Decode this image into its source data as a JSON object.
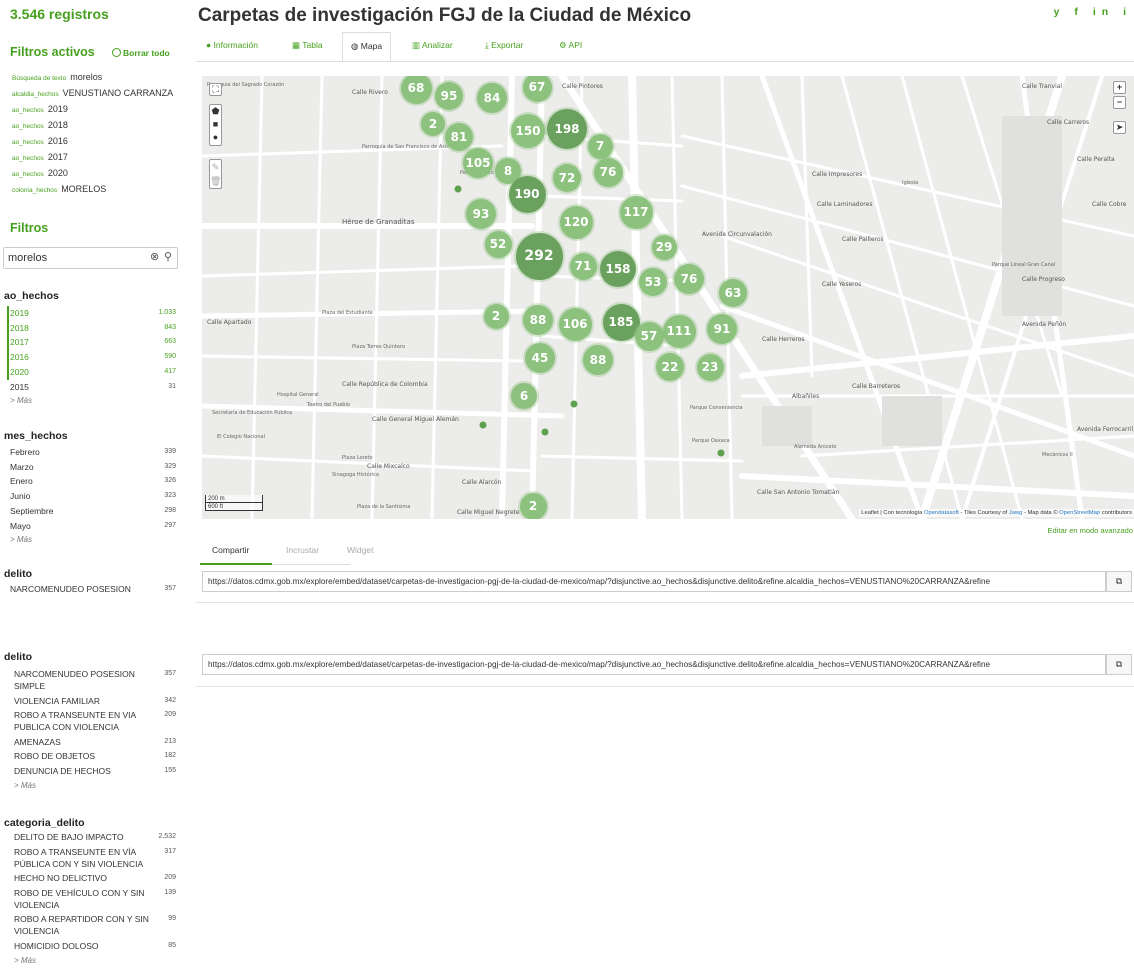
{
  "sidebar": {
    "record_count": "3.546 registros",
    "active_filters_title": "Filtros activos",
    "clear_all": "Borrar todo",
    "active_filters": [
      {
        "field": "Búsqueda de texto",
        "value": "morelos"
      },
      {
        "field": "alcaldia_hechos",
        "value": "VENUSTIANO CARRANZA"
      },
      {
        "field": "ao_hechos",
        "value": "2019"
      },
      {
        "field": "ao_hechos",
        "value": "2018"
      },
      {
        "field": "ao_hechos",
        "value": "2016"
      },
      {
        "field": "ao_hechos",
        "value": "2017"
      },
      {
        "field": "ao_hechos",
        "value": "2020"
      },
      {
        "field": "colonia_hechos",
        "value": "MORELOS"
      }
    ],
    "filters_title": "Filtros",
    "search_value": "morelos",
    "facets": {
      "ao_hechos": {
        "title": "ao_hechos",
        "items": [
          {
            "label": "2019",
            "count": "1.033",
            "selected": true
          },
          {
            "label": "2018",
            "count": "843",
            "selected": true
          },
          {
            "label": "2017",
            "count": "663",
            "selected": true
          },
          {
            "label": "2016",
            "count": "590",
            "selected": true
          },
          {
            "label": "2020",
            "count": "417",
            "selected": true
          },
          {
            "label": "2015",
            "count": "31",
            "selected": false
          }
        ],
        "more": "> Más"
      },
      "mes_hechos": {
        "title": "mes_hechos",
        "items": [
          {
            "label": "Febrero",
            "count": "339"
          },
          {
            "label": "Marzo",
            "count": "329"
          },
          {
            "label": "Enero",
            "count": "326"
          },
          {
            "label": "Junio",
            "count": "323"
          },
          {
            "label": "Septiembre",
            "count": "298"
          },
          {
            "label": "Mayo",
            "count": "297"
          }
        ],
        "more": "> Más"
      },
      "delito_cut": {
        "title": "delito",
        "first": "NARCOMENUDEO POSESION",
        "first_count": "357"
      },
      "delito": {
        "title": "delito",
        "items": [
          {
            "label": "NARCOMENUDEO POSESION SIMPLE",
            "count": "357"
          },
          {
            "label": "VIOLENCIA FAMILIAR",
            "count": "342"
          },
          {
            "label": "ROBO A TRANSEUNTE EN VIA PUBLICA CON VIOLENCIA",
            "count": "209"
          },
          {
            "label": "AMENAZAS",
            "count": "213"
          },
          {
            "label": "ROBO DE OBJETOS",
            "count": "182"
          },
          {
            "label": "DENUNCIA DE HECHOS",
            "count": "155"
          }
        ],
        "more": "> Más"
      },
      "categoria_delito": {
        "title": "categoria_delito",
        "items": [
          {
            "label": "DELITO DE BAJO IMPACTO",
            "count": "2.532"
          },
          {
            "label": "ROBO A TRANSEUNTE EN VÍA PÚBLICA CON Y SIN VIOLENCIA",
            "count": "317"
          },
          {
            "label": "HECHO NO DELICTIVO",
            "count": "209"
          },
          {
            "label": "ROBO DE VEHÍCULO CON Y SIN VIOLENCIA",
            "count": "139"
          },
          {
            "label": "ROBO A REPARTIDOR CON Y SIN VIOLENCIA",
            "count": "99"
          },
          {
            "label": "HOMICIDIO DOLOSO",
            "count": "85"
          }
        ],
        "more": "> Más"
      }
    }
  },
  "main": {
    "title": "Carpetas de investigación FGJ de la Ciudad de México",
    "social": [
      "y",
      "f",
      "in",
      "i"
    ],
    "tabs": [
      {
        "label": "Información",
        "icon": "info-icon"
      },
      {
        "label": "Tabla",
        "icon": "table-icon"
      },
      {
        "label": "Mapa",
        "icon": "globe-icon"
      },
      {
        "label": "Analizar",
        "icon": "chart-icon"
      },
      {
        "label": "Exportar",
        "icon": "download-icon"
      },
      {
        "label": "API",
        "icon": "gears-icon"
      }
    ],
    "active_tab": "Mapa",
    "map": {
      "clusters": [
        "68",
        "95",
        "84",
        "67",
        "2",
        "150",
        "198",
        "81",
        "7",
        "105",
        "8",
        "72",
        "76",
        "190",
        "93",
        "120",
        "117",
        "29",
        "52",
        "292",
        "71",
        "158",
        "53",
        "76",
        "63",
        "2",
        "88",
        "106",
        "185",
        "57",
        "111",
        "91",
        "45",
        "88",
        "22",
        "23",
        "6",
        "2"
      ],
      "street_labels": [
        "Héroe de Granaditas",
        "Calle Apartado",
        "Calle República de Colombia",
        "Calle General Miguel Alemán",
        "Calle San Antonio Tomatlán",
        "Albañiles",
        "Avenida Peñón",
        "Calle Miguel Negrete",
        "Calle Alarcón",
        "Calle Mixcalco",
        "Calle Rivero",
        "Calle Pintores",
        "Calle Carreros",
        "Calle Peralta",
        "Calle Tranvial",
        "Avenida Circunvalación",
        "Calle Impresores",
        "Calle Laminadores",
        "Calle Pailleros",
        "Calle Herreros",
        "Calle Yeseros",
        "Calle Progreso",
        "Calle Cobre",
        "Calle Barreteros",
        "Avenida Ferrocarril"
      ],
      "place_labels": [
        "Plaza del Estudiante",
        "Plaza Torres Quintero",
        "Hospital General",
        "Teatro del Pueblo",
        "Secretaría de Educación Pública",
        "El Colegio Nacional",
        "Plaza Loreto",
        "Sinagoga Histórica",
        "Plaza de la Santísima",
        "Parque Tepito",
        "Parroquia de San Francisco de Asís",
        "Parque Conveniencia",
        "Parque Oaxaca",
        "Alameda Aniceto",
        "Iglesia",
        "Parque Lineal Gran Canal",
        "Mecánicos II",
        "Parroquia del Sagrado Corazón"
      ],
      "scale": [
        "200 m",
        "600 ft"
      ],
      "attribution_prefix": "Leaflet | Con tecnología ",
      "attribution_link1": "Opendatasoft",
      "attribution_mid": " - Tiles Courtesy of ",
      "attribution_link2": "Jawg",
      "attribution_suffix": " - Map data © ",
      "attribution_link3": "OpenStreetMap",
      "attribution_end": " contributors",
      "zoom_in": "+",
      "zoom_out": "−"
    },
    "edit_advanced": "Editar en modo avanzado",
    "share_tabs": [
      "Compartir",
      "Incrustar",
      "Widget"
    ],
    "share_url": "https://datos.cdmx.gob.mx/explore/embed/dataset/carpetas-de-investigacion-pgj-de-la-ciudad-de-mexico/map/?disjunctive.ao_hechos&disjunctive.delito&refine.alcaldia_hechos=VENUSTIANO%20CARRANZA&refine",
    "share_url_2": "https://datos.cdmx.gob.mx/explore/embed/dataset/carpetas-de-investigacion-pgj-de-la-ciudad-de-mexico/map/?disjunctive.ao_hechos&disjunctive.delito&refine.alcaldia_hechos=VENUSTIANO%20CARRANZA&refine"
  },
  "colors": {
    "accent": "#47a11f",
    "cluster_light": "#8cc17e",
    "cluster_dark": "#6aa15e"
  }
}
